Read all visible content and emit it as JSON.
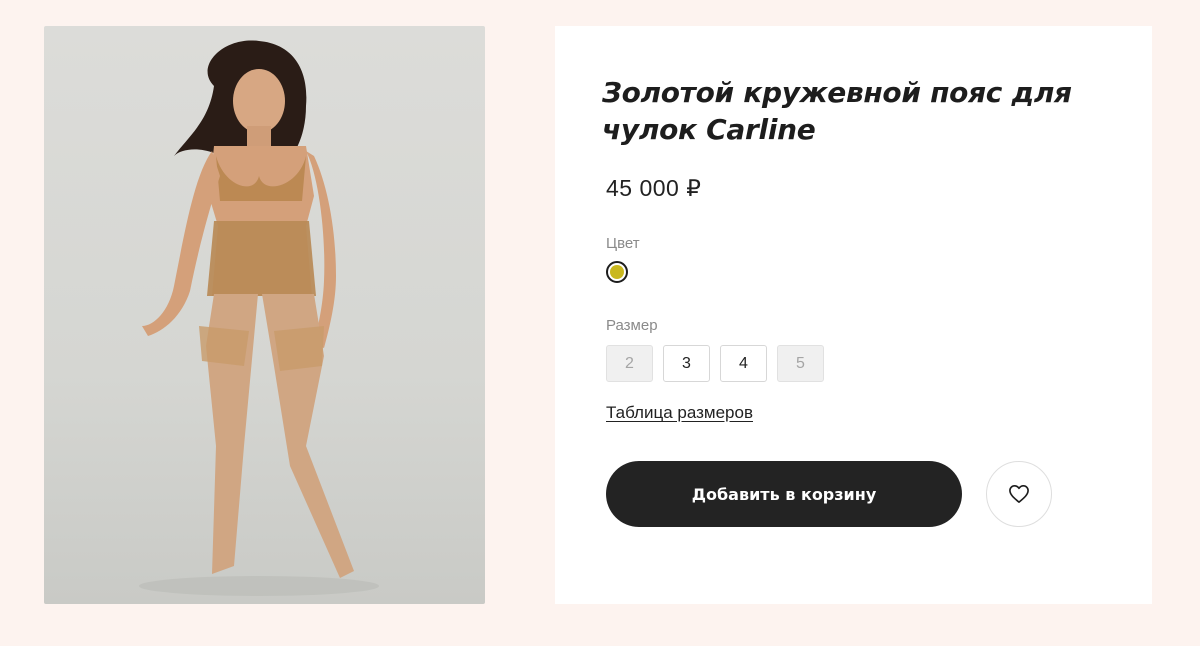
{
  "product": {
    "title": "Золотой кружевной пояс для чулок Carline",
    "price": "45 000 ₽",
    "image_alt": "model-photo"
  },
  "color": {
    "label": "Цвет",
    "selected": {
      "name": "gold",
      "hex": "#c9b81e"
    }
  },
  "size": {
    "label": "Размер",
    "options": [
      {
        "value": "2",
        "available": false
      },
      {
        "value": "3",
        "available": true
      },
      {
        "value": "4",
        "available": true
      },
      {
        "value": "5",
        "available": false
      }
    ],
    "table_link": "Таблица размеров"
  },
  "actions": {
    "add_to_cart": "Добавить в корзину",
    "favorite_icon": "heart-icon"
  },
  "colors": {
    "page_bg": "#fdf3ef",
    "button_dark": "#232323",
    "swatch_gold": "#c9b81e"
  }
}
